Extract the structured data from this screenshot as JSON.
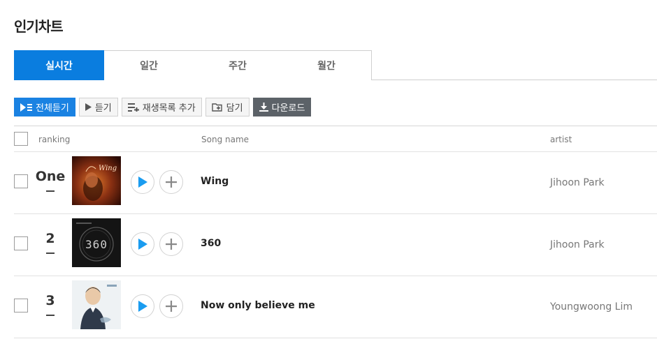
{
  "page_title": "인기차트",
  "tabs": [
    {
      "label": "실시간",
      "active": true
    },
    {
      "label": "일간",
      "active": false
    },
    {
      "label": "주간",
      "active": false
    },
    {
      "label": "월간",
      "active": false
    }
  ],
  "toolbar": {
    "play_all": "전체듣기",
    "listen": "듣기",
    "add_playlist": "재생목록 추가",
    "save": "담기",
    "download": "다운로드"
  },
  "columns": {
    "ranking": "ranking",
    "song": "Song name",
    "artist": "artist"
  },
  "songs": [
    {
      "rank": "One",
      "rank_change": "-",
      "title": "Wing",
      "artist": "Jihoon Park",
      "cover": "wing-cover-art",
      "cover_text": "Wing"
    },
    {
      "rank": "2",
      "rank_change": "-",
      "title": "360",
      "artist": "Jihoon Park",
      "cover": "360-cover-art",
      "cover_text": "360"
    },
    {
      "rank": "3",
      "rank_change": "-",
      "title": "Now only believe me",
      "artist": "Youngwoong Lim",
      "cover": "portrait-cover-art"
    }
  ],
  "colors": {
    "accent": "#0a7ddf",
    "play_icon": "#1a9cf0",
    "dark_button": "#5c6268"
  }
}
